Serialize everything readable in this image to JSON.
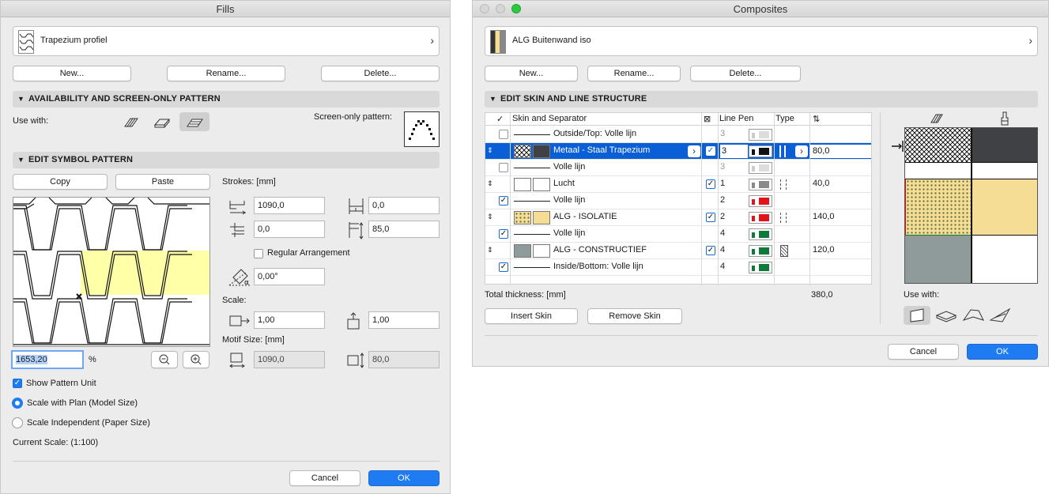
{
  "fills": {
    "title": "Fills",
    "selector_name": "Trapezium profiel",
    "buttons": {
      "new": "New...",
      "rename": "Rename...",
      "delete": "Delete..."
    },
    "section1": "AVAILABILITY AND SCREEN-ONLY PATTERN",
    "use_with": "Use with:",
    "screen_only": "Screen-only pattern:",
    "section2": "EDIT SYMBOL PATTERN",
    "copy": "Copy",
    "paste": "Paste",
    "strokes": "Strokes: [mm]",
    "f1": "1090,0",
    "f2": "0,0",
    "f3": "0,0",
    "f4": "85,0",
    "regular": "Regular Arrangement",
    "angle": "0,00°",
    "scale": "Scale:",
    "scale_x": "1,00",
    "scale_y": "1,00",
    "motif": "Motif Size: [mm]",
    "motif_x": "1090,0",
    "motif_y": "80,0",
    "zoom": "1653,20",
    "percent": "%",
    "show_unit": "Show Pattern Unit",
    "scale_plan": "Scale with Plan (Model Size)",
    "scale_indep": "Scale Independent (Paper Size)",
    "current_scale": "Current Scale: (1:100)",
    "cancel": "Cancel",
    "ok": "OK",
    "colors": {
      "highlight": "#ffffa8",
      "accent": "#1f7bf2"
    }
  },
  "composites": {
    "title": "Composites",
    "selector_name": "ALG Buitenwand iso",
    "buttons": {
      "new": "New...",
      "rename": "Rename...",
      "delete": "Delete..."
    },
    "section": "EDIT SKIN AND LINE STRUCTURE",
    "header": {
      "check": "✓",
      "skin": "Skin and Separator",
      "line_pen": "Line Pen",
      "type": "Type",
      "mark": "⇅",
      "core": "⊠"
    },
    "rows": [
      {
        "name": "Outside/Top: Volle lijn",
        "pen": "3",
        "thickness": ""
      },
      {
        "name": "Metaal - Staal Trapezium",
        "pen": "3",
        "thickness": "80,0"
      },
      {
        "name": "Volle lijn",
        "pen": "3",
        "thickness": ""
      },
      {
        "name": "Lucht",
        "pen": "1",
        "thickness": "40,0"
      },
      {
        "name": "Volle lijn",
        "pen": "2",
        "thickness": ""
      },
      {
        "name": "ALG - ISOLATIE",
        "pen": "2",
        "thickness": "140,0"
      },
      {
        "name": "Volle lijn",
        "pen": "4",
        "thickness": ""
      },
      {
        "name": "ALG - CONSTRUCTIEF",
        "pen": "4",
        "thickness": "120,0"
      },
      {
        "name": "Inside/Bottom: Volle lijn",
        "pen": "4",
        "thickness": ""
      }
    ],
    "total_label": "Total thickness: [mm]",
    "total_value": "380,0",
    "insert_skin": "Insert Skin",
    "remove_skin": "Remove Skin",
    "use_with": "Use with:",
    "cancel": "Cancel",
    "ok": "OK",
    "colors": {
      "selection": "#0b5fd6",
      "pen_red": "#e0141a",
      "pen_green": "#0e7a3a",
      "steel": "#3f4145",
      "insul": "#f6dd95",
      "concrete": "#8f9a9a"
    }
  }
}
